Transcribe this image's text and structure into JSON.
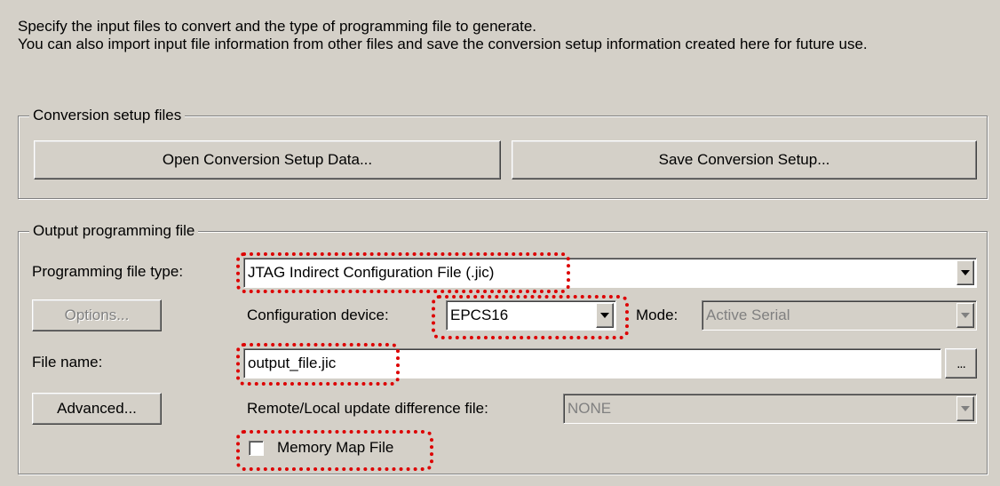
{
  "intro": {
    "line1": "Specify the input files to convert and the type of programming file to generate.",
    "line2": "You can also import input file information from other files and save the conversion setup information created here for future use."
  },
  "conversion_setup": {
    "legend": "Conversion setup files",
    "open_button": "Open Conversion Setup Data...",
    "save_button": "Save Conversion Setup..."
  },
  "output": {
    "legend": "Output programming file",
    "file_type_label": "Programming file type:",
    "file_type_value": "JTAG Indirect Configuration File (.jic)",
    "options_button": "Options...",
    "config_device_label": "Configuration device:",
    "config_device_value": "EPCS16",
    "mode_label": "Mode:",
    "mode_value": "Active Serial",
    "file_name_label": "File name:",
    "file_name_value": "output_file.jic",
    "browse_button": "...",
    "advanced_button": "Advanced...",
    "remote_local_label": "Remote/Local update difference file:",
    "remote_local_value": "NONE",
    "memory_map_label": "Memory Map File",
    "memory_map_checked": false
  },
  "colors": {
    "dialog_bg": "#d4d0c8",
    "highlight": "#dd0000",
    "disabled_text": "#808080"
  }
}
